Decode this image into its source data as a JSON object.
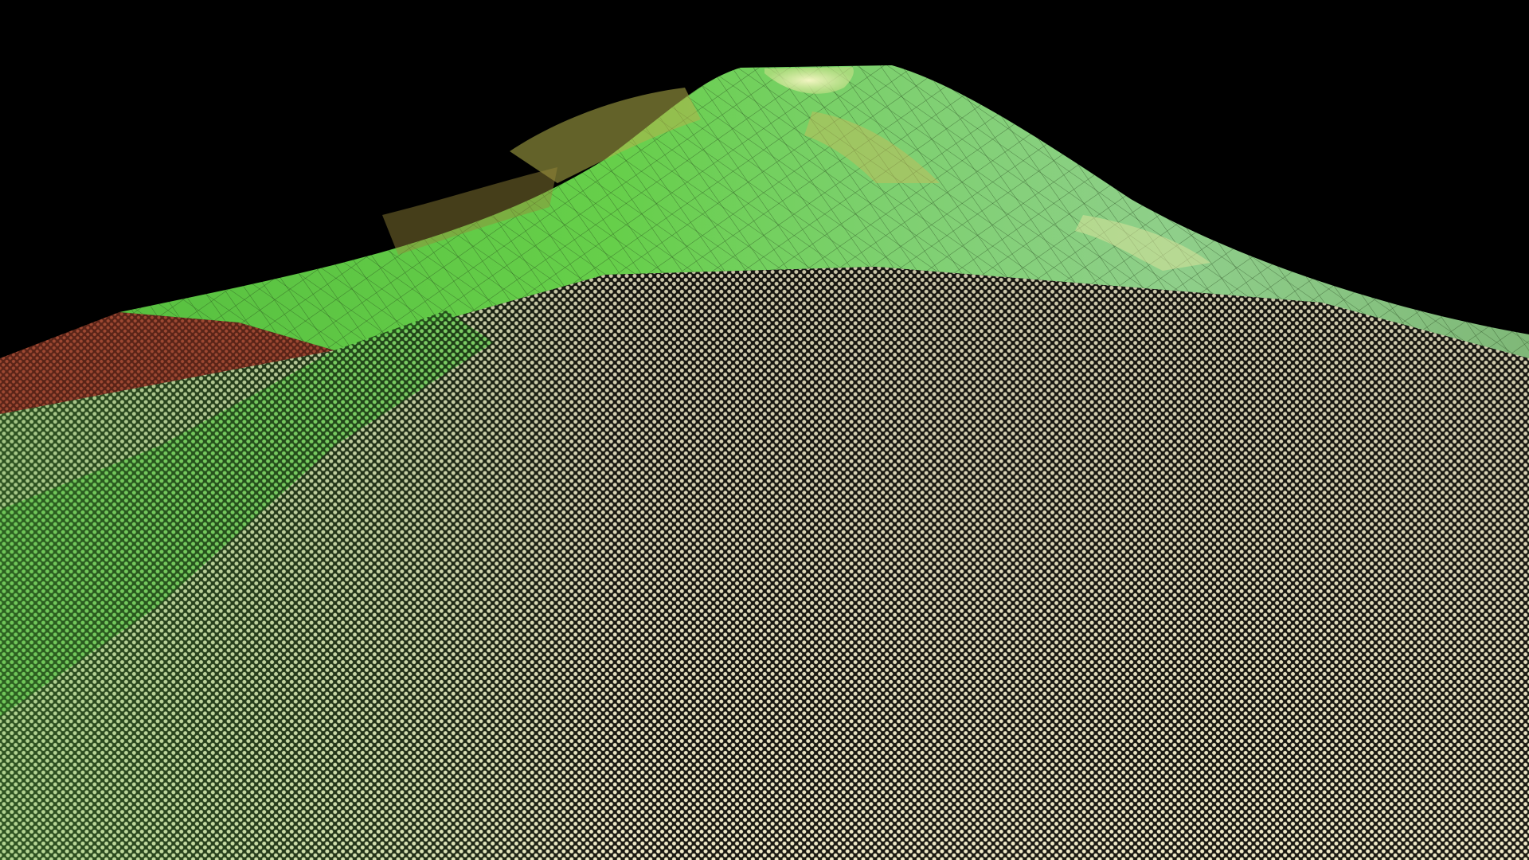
{
  "scene": {
    "subject": "wireframe-terrain-mountain",
    "colors": {
      "sky": "#000000",
      "upper_slope": "#5cd24a",
      "upper_slope_highlight": "#c8e68a",
      "slope_ochre": "#b5b24a",
      "left_ridge": "#8a3a26",
      "right_ridge": "#7a3326",
      "foreground_green": "#3f8f30",
      "foreground_mesh_light": "#efe9c6",
      "foreground_mesh_dark": "#1b1a14",
      "crater_rim": "#e8f0a8"
    }
  }
}
